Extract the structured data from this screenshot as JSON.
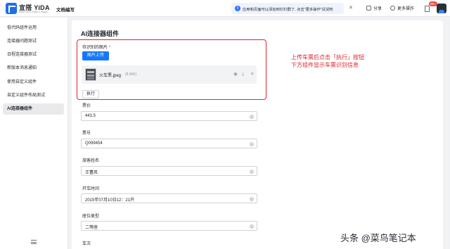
{
  "header": {
    "logo_text": "宜搭 YiDA",
    "logo_tagline": "Make Work Easy & Happy",
    "app_title": "文档编写",
    "notice_text": "应用和页面可以添加到钉钉群了, 点击\"更多操作\"试试吧",
    "share_label": "分享",
    "more_actions_label": "更多操作",
    "badge_count": "99+"
  },
  "sidebar": {
    "items": [
      {
        "label": "低代码组件运用"
      },
      {
        "label": "连接器问题测试"
      },
      {
        "label": "日程连接器测试"
      },
      {
        "label": "新版本消息通知"
      },
      {
        "label": "使用自定义组件"
      },
      {
        "label": "自定义组件布局测试"
      },
      {
        "label": "AI连接器组件"
      }
    ],
    "active_index": 6
  },
  "main": {
    "title": "AI连接器组件",
    "image_field_label": "待识别的图片",
    "required_mark": "*",
    "upload_button": "图片上传",
    "file_name": "火车票.jpeg",
    "file_size": "(8.46K)",
    "execute_button": "执行",
    "fields": [
      {
        "label": "票价",
        "value": "443.5"
      },
      {
        "label": "票号",
        "value": "Q099454"
      },
      {
        "label": "旅客姓名",
        "value": "王曹风"
      },
      {
        "label": "开车时间",
        "value": "2015年07月10日12：21开"
      },
      {
        "label": "座位类型",
        "value": "二等座"
      },
      {
        "label": "车次",
        "value": ""
      }
    ]
  },
  "annotation": {
    "line1": "上传车票后点击「执行」按钮",
    "line2": "下方组件显示车票识别信息"
  },
  "watermark": "头条 @菜鸟笔记本",
  "colors": {
    "primary": "#1677ff",
    "highlight": "#e0242f",
    "active_nav": "#e9eaec"
  }
}
